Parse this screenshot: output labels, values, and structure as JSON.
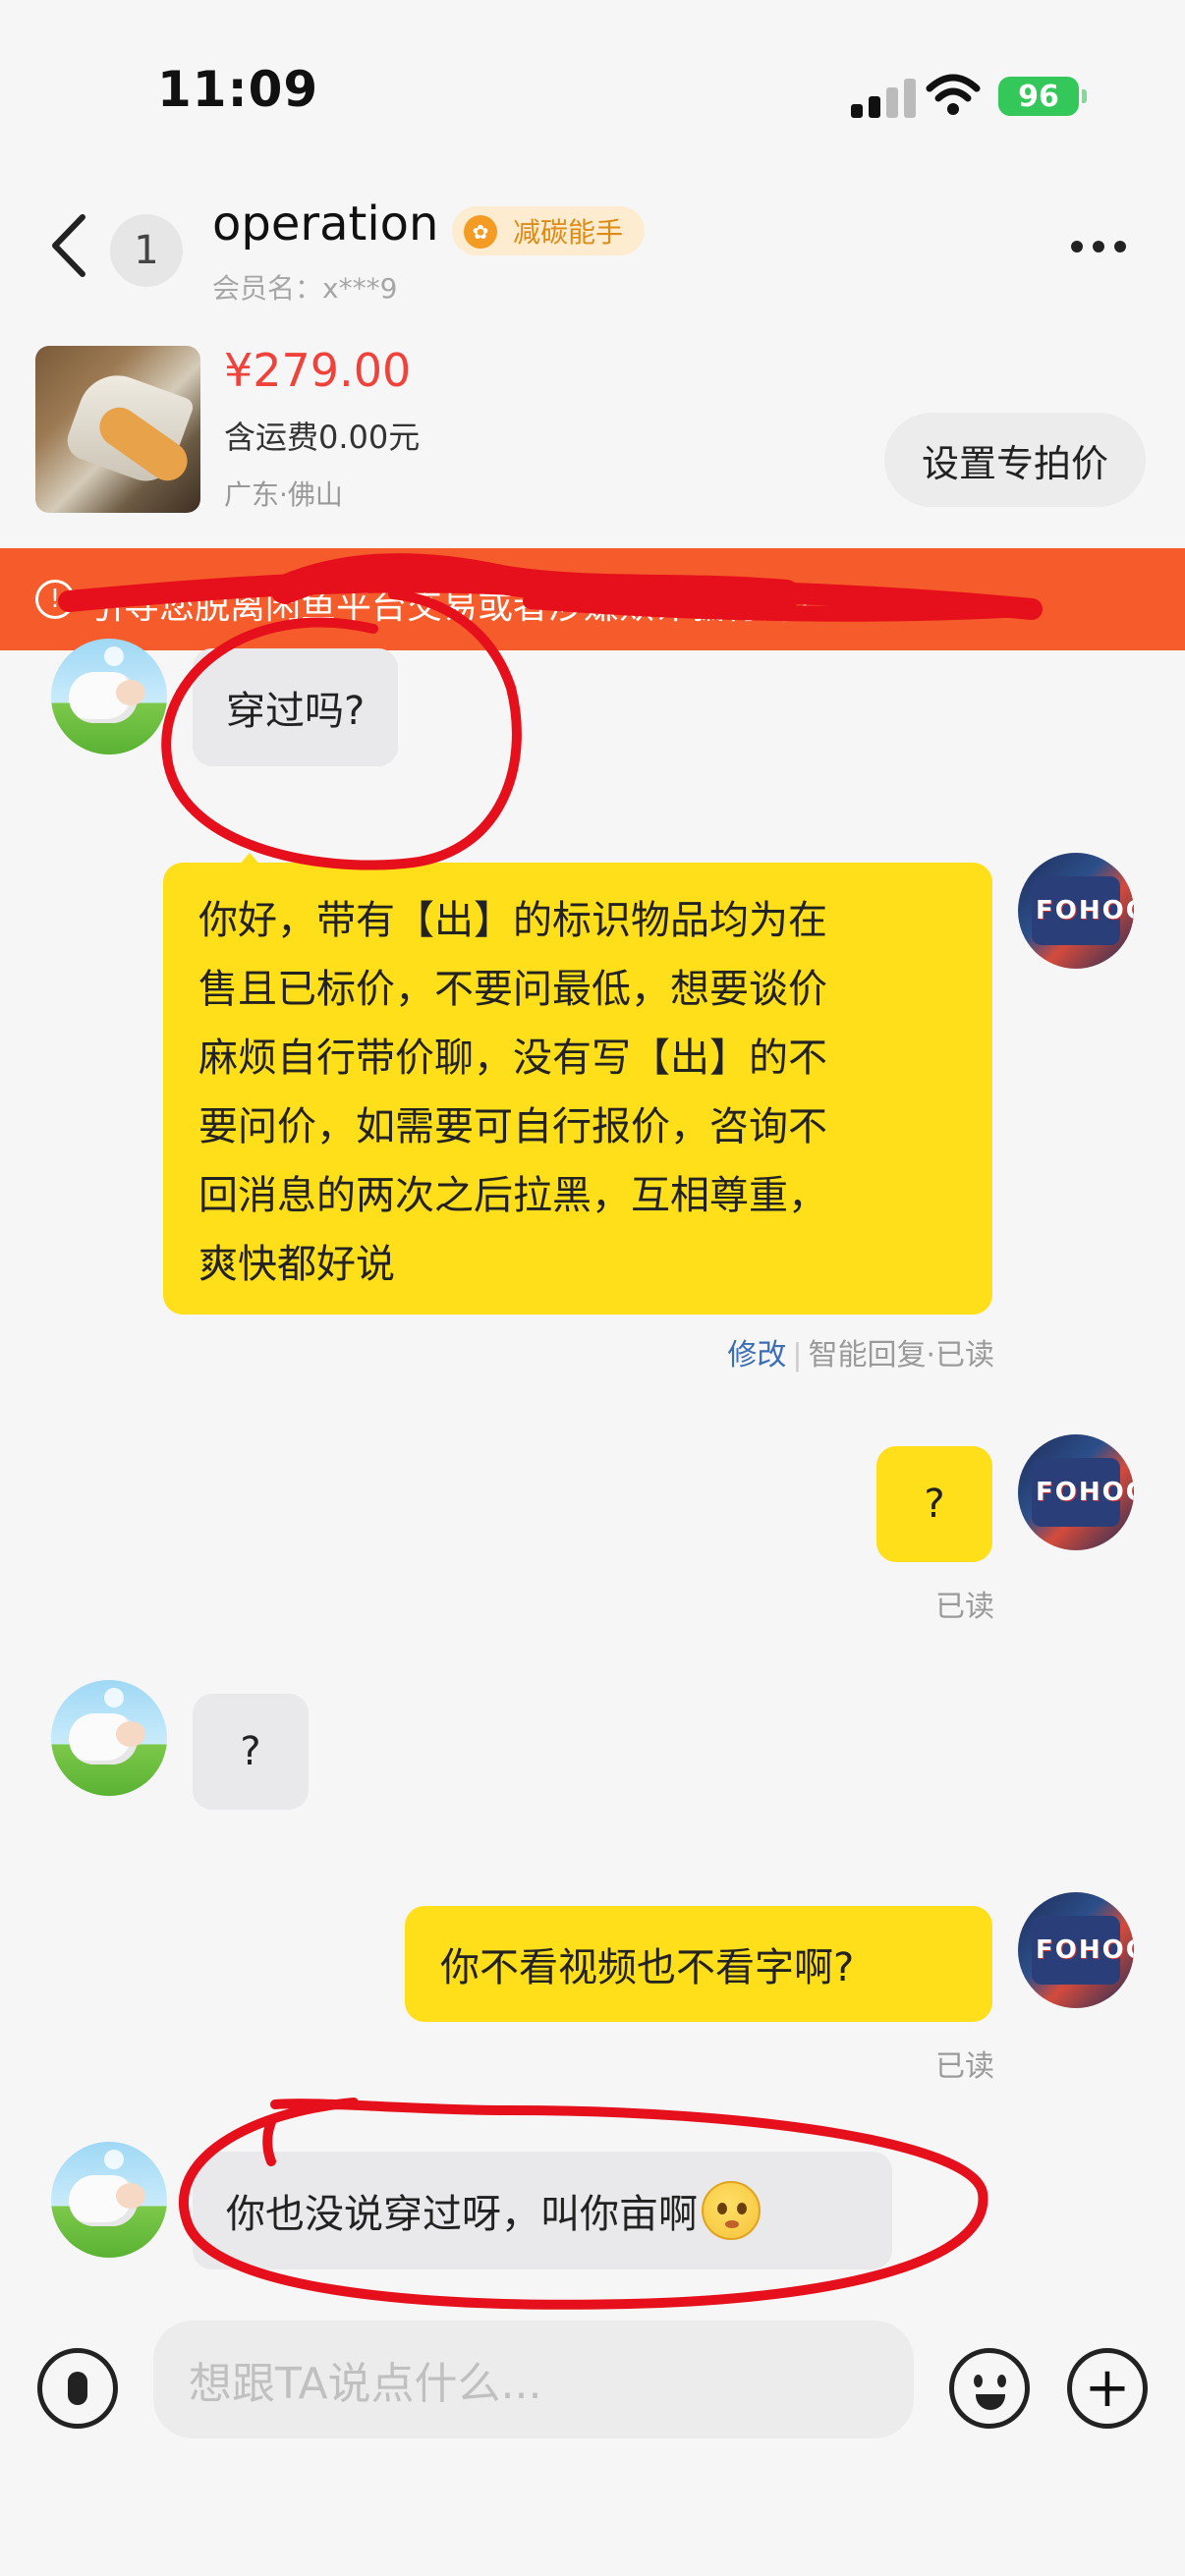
{
  "status_bar": {
    "time": "11:09",
    "battery": "96"
  },
  "header": {
    "unread_count": "1",
    "contact_name": "operation",
    "badge": "减碳能手",
    "member_label": "会员名：x***9"
  },
  "product": {
    "price": "¥279.00",
    "shipping": "含运费0.00元",
    "location": "广东·佛山",
    "set_price_button": "设置专拍价"
  },
  "warning_banner": {
    "text": "引导您脱离闲鱼平台交易或者涉嫌欺诈骗行为！"
  },
  "messages": [
    {
      "from": "other",
      "text": "穿过吗?"
    },
    {
      "from": "me",
      "text": "你好，带有【出】的标识物品均为在售且已标价，不要问最低，想要谈价麻烦自行带价聊，没有写【出】的不要问价，如需要可自行报价，咨询不回消息的两次之后拉黑，互相尊重，爽快都好说",
      "lines": [
        "你好，带有【出】的标识物品均为在",
        "售且已标价，不要问最低，想要谈价",
        "麻烦自行带价聊，没有写【出】的不",
        "要问价，如需要可自行报价，咨询不",
        "回消息的两次之后拉黑，互相尊重，",
        "爽快都好说"
      ],
      "edit_label": "修改",
      "status": "智能回复·已读"
    },
    {
      "from": "me",
      "text": "?",
      "status": "已读"
    },
    {
      "from": "other",
      "text": "?"
    },
    {
      "from": "me",
      "text": "你不看视频也不看字啊?",
      "status": "已读"
    },
    {
      "from": "other",
      "text": "你也没说穿过呀，叫你亩啊"
    }
  ],
  "input": {
    "placeholder": "想跟TA说点什么..."
  },
  "colors": {
    "accent_yellow": "#ffde1a",
    "price_red": "#f0413a",
    "banner_orange": "#f55b2b",
    "markup_red": "#e5101b"
  }
}
